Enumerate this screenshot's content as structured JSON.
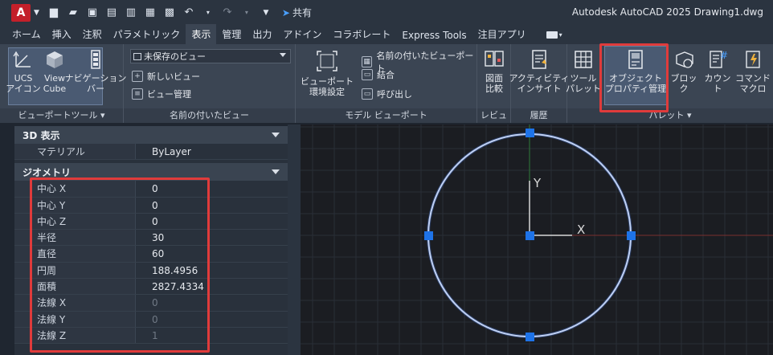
{
  "title": {
    "app_title": "Autodesk AutoCAD 2025   Drawing1.dwg",
    "share": "共有",
    "logo": "A"
  },
  "tabs": [
    "ホーム",
    "挿入",
    "注釈",
    "パラメトリック",
    "表示",
    "管理",
    "出力",
    "アドイン",
    "コラボレート",
    "Express Tools",
    "注目アプリ"
  ],
  "active_tab": "表示",
  "ribbon": {
    "viewport_tools": {
      "ucs": "UCS\nアイコン",
      "viewcube": "View\nCube",
      "nav": "ナビゲーション\nバー",
      "label": "ビューポートツール ▾"
    },
    "named_views": {
      "dropdown": "未保存のビュー",
      "new_view": "新しいビュー",
      "view_manager": "ビュー管理",
      "label": "名前の付いたビュー"
    },
    "model_viewports": {
      "config": "ビューポート\n環境設定",
      "named": "名前の付いたビューポート",
      "join": "結合",
      "restore": "呼び出し",
      "label": "モデル ビューポート"
    },
    "review": {
      "compare": "図面\n比較",
      "label": "レビュー"
    },
    "history": {
      "insights": "アクティビティ\nインサイト",
      "label": "履歴"
    },
    "palettes": {
      "tool_palette": "ツール\nパレット",
      "properties": "オブジェクト\nプロパティ管理",
      "block": "ブロック",
      "count": "カウント",
      "command_macro": "コマンド\nマクロ",
      "label": "パレット ▾"
    }
  },
  "properties": {
    "section_3d": "3D 表示",
    "material": {
      "name": "マテリアル",
      "value": "ByLayer"
    },
    "section_geometry": "ジオメトリ",
    "rows": [
      {
        "name": "中心 X",
        "value": "0"
      },
      {
        "name": "中心 Y",
        "value": "0"
      },
      {
        "name": "中心 Z",
        "value": "0"
      },
      {
        "name": "半径",
        "value": "30"
      },
      {
        "name": "直径",
        "value": "60"
      },
      {
        "name": "円周",
        "value": "188.4956"
      },
      {
        "name": "面積",
        "value": "2827.4334"
      },
      {
        "name": "法線 X",
        "value": "0"
      },
      {
        "name": "法線 Y",
        "value": "0"
      },
      {
        "name": "法線 Z",
        "value": "1"
      }
    ]
  },
  "canvas": {
    "axis_x": "X",
    "axis_y": "Y",
    "circle_color": "#ffffff",
    "grip_color": "#1e73e8"
  }
}
